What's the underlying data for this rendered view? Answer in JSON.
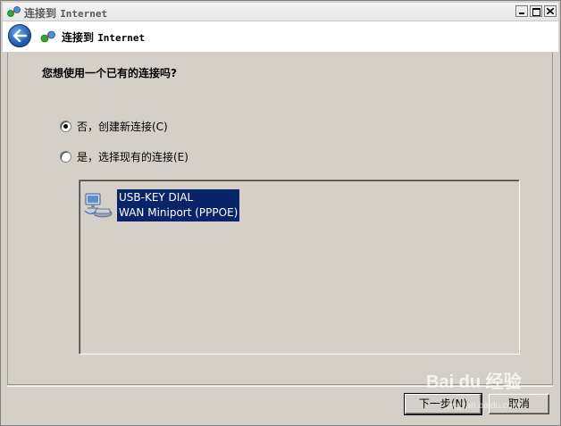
{
  "window": {
    "title_prefix": "连接到 ",
    "title_suffix": "Internet"
  },
  "header": {
    "title_prefix": "连接到 ",
    "title_suffix": "Internet"
  },
  "main": {
    "question": "您想使用一个已有的连接吗?",
    "options": [
      {
        "label": "否，创建新连接(C)",
        "checked": true
      },
      {
        "label": "是，选择现有的连接(E)",
        "checked": false
      }
    ],
    "connection_list": [
      {
        "line1": "USB-KEY DIAL",
        "line2": "WAN Miniport (PPPOE)"
      }
    ]
  },
  "footer": {
    "next_label": "下一步(N)",
    "cancel_label": "取消"
  },
  "watermark": {
    "text": "Bai du 经验",
    "sub": "jingyan.baidu.com"
  }
}
